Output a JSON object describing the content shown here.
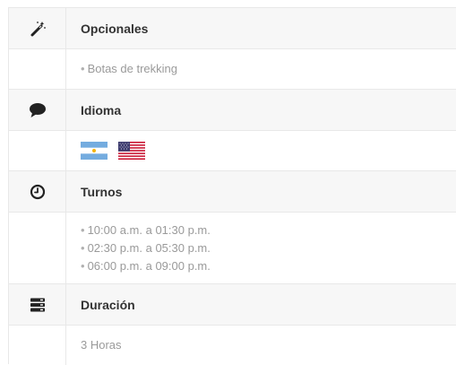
{
  "sections": [
    {
      "id": "opcionales",
      "icon": "magic-wand-icon",
      "title": "Opcionales",
      "items": [
        "Botas de trekking"
      ]
    },
    {
      "id": "idioma",
      "icon": "speech-bubble-icon",
      "title": "Idioma",
      "flags": [
        "argentina-flag-icon",
        "usa-flag-icon"
      ]
    },
    {
      "id": "turnos",
      "icon": "clock-icon",
      "title": "Turnos",
      "items": [
        "10:00 a.m. a 01:30 p.m.",
        "02:30 p.m. a 05:30 p.m.",
        "06:00 p.m. a 09:00 p.m."
      ]
    },
    {
      "id": "duracion",
      "icon": "server-icon",
      "title": "Duración",
      "value": "3 Horas"
    }
  ],
  "bullet_char": "•",
  "colors": {
    "header_bg": "#f7f7f7",
    "border": "#e8e8e8",
    "muted_text": "#9a9a9a",
    "title_text": "#333333"
  }
}
